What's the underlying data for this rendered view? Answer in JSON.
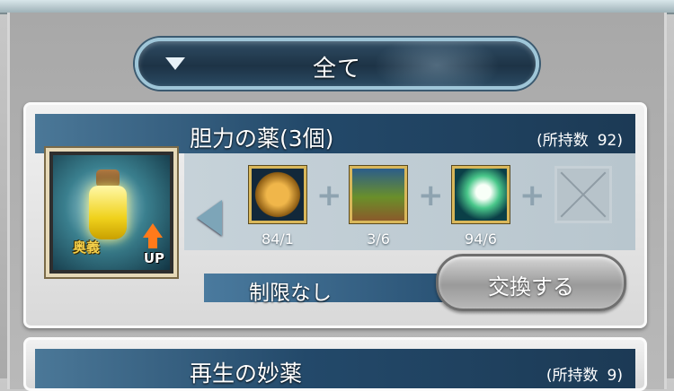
{
  "filter": {
    "label": "全て",
    "icon": "triangle-down-icon"
  },
  "items": [
    {
      "title": "胆力の薬(3個)",
      "owned_label": "(所持数",
      "owned_count": "92)",
      "thumbnail": {
        "badge": "奥義",
        "up": "UP"
      },
      "materials": [
        {
          "icon": "gold-coin-material-icon",
          "count": "84/1"
        },
        {
          "icon": "treasure-box-material-icon",
          "count": "3/6"
        },
        {
          "icon": "feather-material-icon",
          "count": "94/6"
        },
        {
          "icon": "empty-slot-icon",
          "count": ""
        }
      ],
      "limit": "制限なし",
      "exchange_label": "交換する"
    },
    {
      "title": "再生の妙薬",
      "owned_label": "(所持数",
      "owned_count": "9)"
    }
  ],
  "colors": {
    "header": "#23496a",
    "accent": "#9fc6d8",
    "button": "#9a9a9a"
  }
}
